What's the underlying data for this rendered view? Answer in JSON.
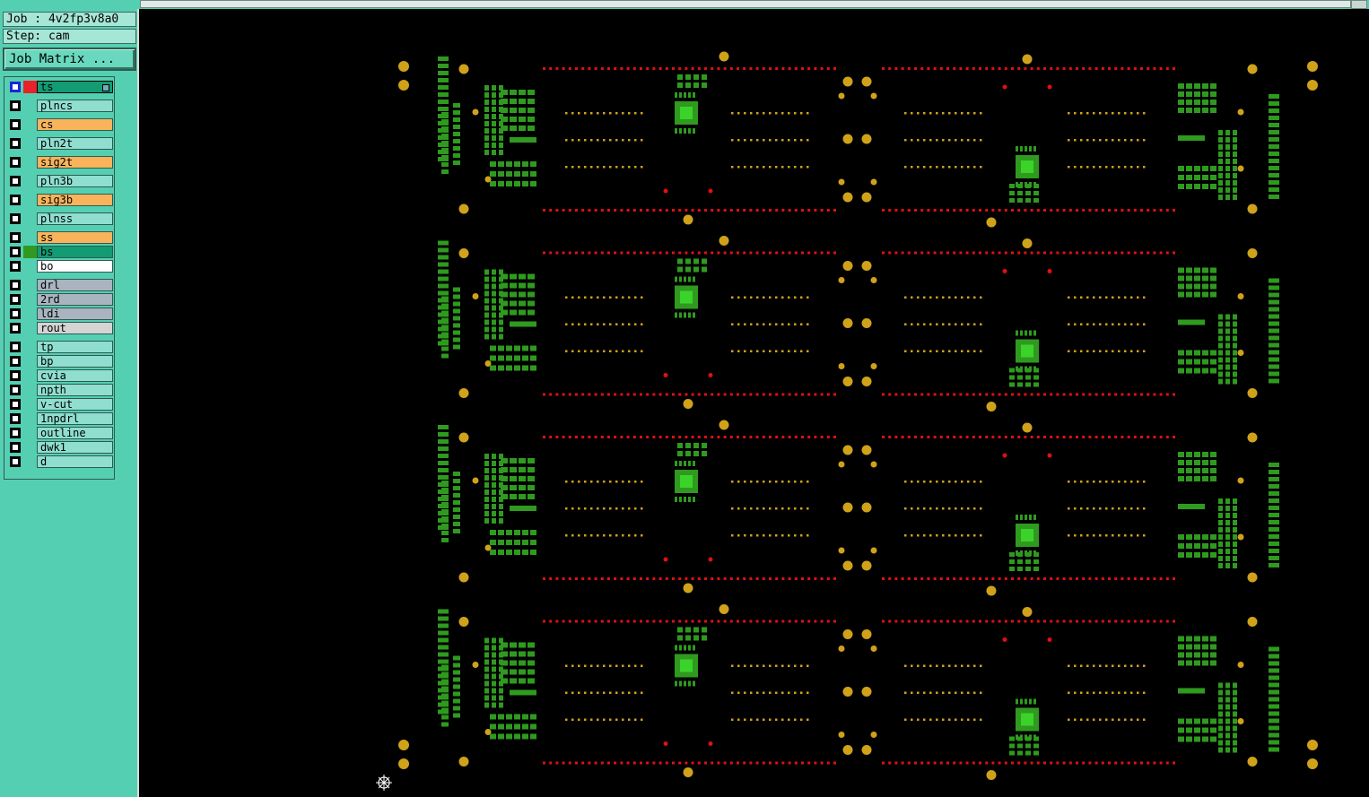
{
  "job": {
    "label": "Job : 4v2fp3v8a0"
  },
  "step": {
    "label": "Step: cam"
  },
  "job_matrix_button": {
    "label": "Job Matrix ..."
  },
  "layers": [
    {
      "name": "ts",
      "color": "#139b73",
      "swatch": "#e8212a",
      "active": true
    },
    {
      "name": "plncs",
      "color": "#8fded0"
    },
    {
      "name": "cs",
      "color": "#f9b45b"
    },
    {
      "name": "pln2t",
      "color": "#8fded0"
    },
    {
      "name": "sig2t",
      "color": "#f9b45b"
    },
    {
      "name": "pln3b",
      "color": "#8fded0"
    },
    {
      "name": "sig3b",
      "color": "#f9b45b"
    },
    {
      "name": "plnss",
      "color": "#8fded0"
    },
    {
      "name": "ss",
      "color": "#f9b45b"
    },
    {
      "name": "bs",
      "color": "#139b73",
      "swatch": "#2f9a1f"
    },
    {
      "name": "bo",
      "color": "#ffffff"
    },
    {
      "name": "drl",
      "color": "#a9b4c0"
    },
    {
      "name": "2rd",
      "color": "#a9b4c0"
    },
    {
      "name": "ldi",
      "color": "#a9b4c0"
    },
    {
      "name": "rout",
      "color": "#d4d4d4"
    },
    {
      "name": "tp",
      "color": "#8fded0"
    },
    {
      "name": "bp",
      "color": "#8fded0"
    },
    {
      "name": "cvia",
      "color": "#8fded0"
    },
    {
      "name": "npth",
      "color": "#8fded0"
    },
    {
      "name": "v-cut",
      "color": "#8fded0"
    },
    {
      "name": "1npdrl",
      "color": "#8fded0"
    },
    {
      "name": "outline",
      "color": "#8fded0"
    },
    {
      "name": "dwk1",
      "color": "#8fded0"
    },
    {
      "name": "d",
      "color": "#8fded0"
    }
  ],
  "colors": {
    "panel_bg": "#55cfb2",
    "canvas_bg": "#000000",
    "pad_green": "#2f9a1f",
    "pad_red": "#e01010",
    "pad_gold": "#cfa21a"
  },
  "board": {
    "panel_count": 4,
    "view": "pcb-layout"
  }
}
